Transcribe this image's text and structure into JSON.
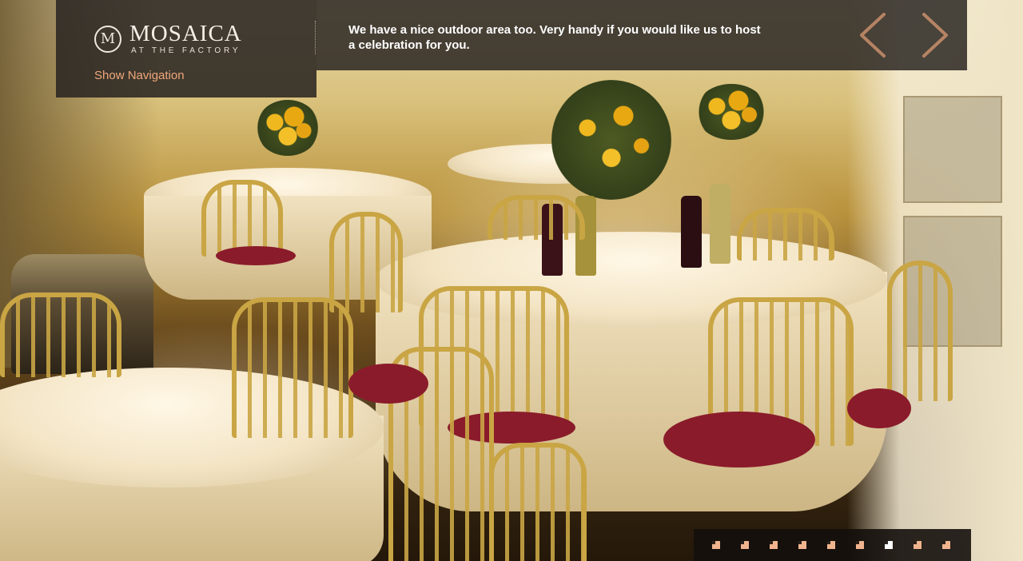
{
  "brand": {
    "logo_initial": "M",
    "name": "MOSAICA",
    "tagline": "AT THE FACTORY"
  },
  "nav": {
    "toggle_label": "Show Navigation"
  },
  "slide": {
    "caption": "We have a nice outdoor area too. Very handy if you would like us to host a celebration for you.",
    "prev_icon": "chevron-left-icon",
    "next_icon": "chevron-right-icon"
  },
  "pager": {
    "total": 9,
    "active_index": 6
  },
  "colors": {
    "accent": "#f1a87b",
    "overlay": "#2a2622",
    "caption_text": "#ffffff",
    "pager_dot": "#f0b48e",
    "pager_active": "#ffffff"
  }
}
